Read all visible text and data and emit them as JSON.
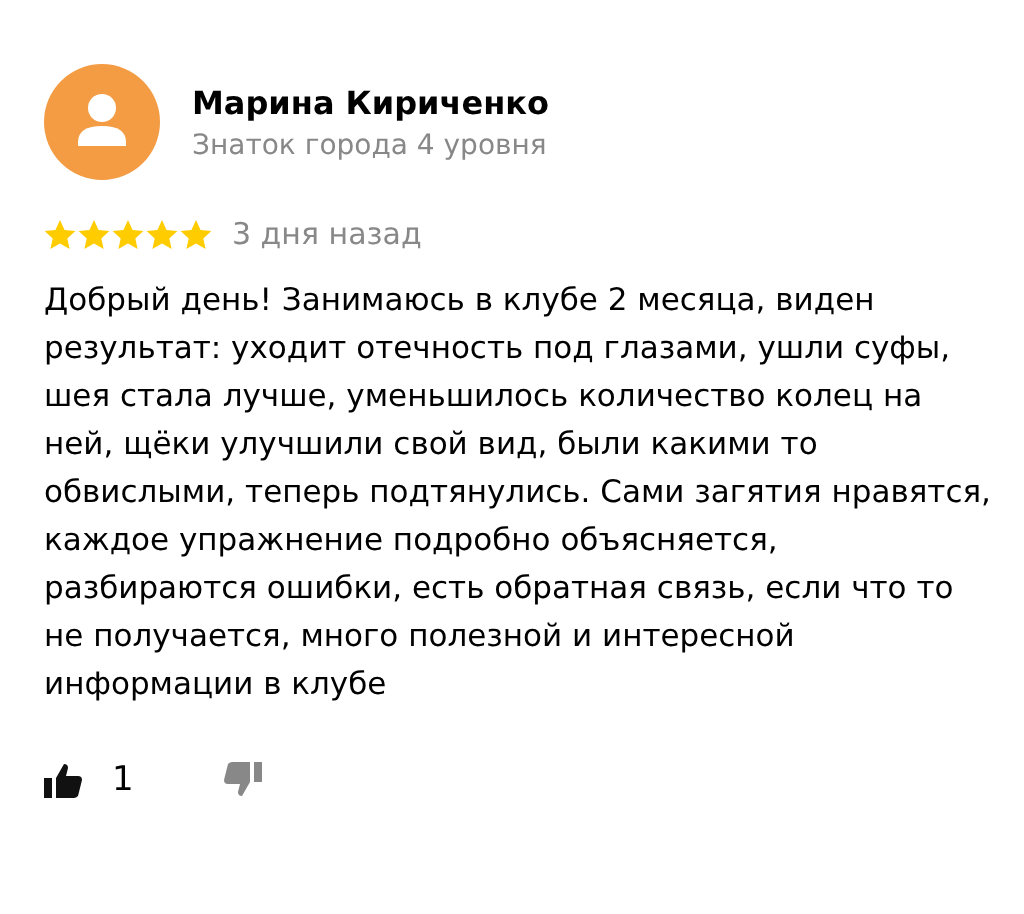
{
  "review": {
    "author": "Марина Кириченко",
    "author_status": "Знаток города 4 уровня",
    "stars": 5,
    "date": "3 дня назад",
    "text": "Добрый день! Занимаюсь в клубе 2 месяца, виден результат: уходит отечность под глазами, ушли суфы, шея стала лучше, уменьшилось количество колец на ней, щёки улучшили свой вид, были какими то обвислыми, теперь подтянулись. Сами загятия нравятся, каждое упражнение подробно объясняется, разбираются ошибки, есть обратная связь, если что то не получается, много полезной и интересной информации в клубе",
    "likes": "1"
  }
}
